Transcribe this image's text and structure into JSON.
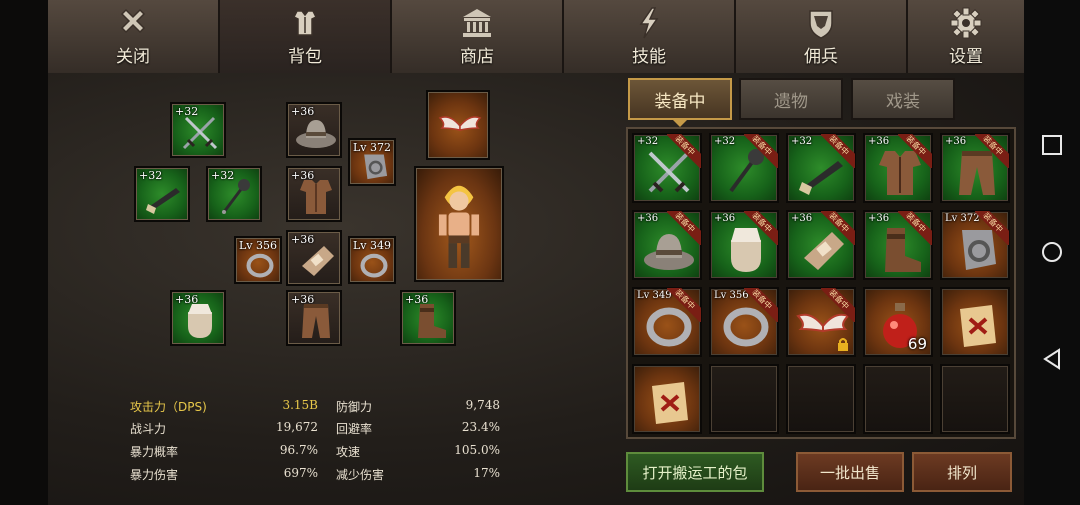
{
  "nav": {
    "tabs": [
      {
        "label": "关闭",
        "icon": "close-x-icon",
        "active": false
      },
      {
        "label": "背包",
        "icon": "armor-icon",
        "active": true
      },
      {
        "label": "商店",
        "icon": "shop-building-icon",
        "active": false
      },
      {
        "label": "技能",
        "icon": "lightning-icon",
        "active": false
      },
      {
        "label": "佣兵",
        "icon": "shield-icon",
        "active": false
      },
      {
        "label": "设置",
        "icon": "gear-icon",
        "active": false
      }
    ]
  },
  "equipment": {
    "slots": [
      {
        "badge": "+32",
        "item": "crossed-swords-icon"
      },
      {
        "badge": "+36",
        "item": "hat-icon"
      },
      {
        "badge": "Lv 372",
        "item": "bracer-icon"
      },
      {
        "badge": "+32",
        "item": "gun-icon"
      },
      {
        "badge": "+32",
        "item": "mace-icon"
      },
      {
        "badge": "+36",
        "item": "armor-chest-icon"
      },
      {
        "badge": "Lv 356",
        "item": "ring-icon"
      },
      {
        "badge": "+36",
        "item": "gauntlet-icon"
      },
      {
        "badge": "Lv 349",
        "item": "ring-icon"
      },
      {
        "badge": "+36",
        "item": "glove-icon"
      },
      {
        "badge": "+36",
        "item": "pants-icon"
      },
      {
        "badge": "+36",
        "item": "boots-icon"
      }
    ],
    "wings": "wings-icon",
    "character": "hero-character"
  },
  "stats": {
    "left": [
      {
        "label": "攻击力（DPS)",
        "value": "3.15B"
      },
      {
        "label": "战斗力",
        "value": "19,672"
      },
      {
        "label": "暴力概率",
        "value": "96.7%"
      },
      {
        "label": "暴力伤害",
        "value": "697%"
      }
    ],
    "right": [
      {
        "label": "防御力",
        "value": "9,748"
      },
      {
        "label": "回避率",
        "value": "23.4%"
      },
      {
        "label": "攻速",
        "value": "105.0%"
      },
      {
        "label": "减少伤害",
        "value": "17%"
      }
    ]
  },
  "inventory": {
    "tabs": [
      {
        "label": "装备中",
        "active": true
      },
      {
        "label": "遗物",
        "active": false
      },
      {
        "label": "戏装",
        "active": false
      }
    ],
    "equipped_tag": "装备中",
    "items": [
      {
        "badge": "+32",
        "item": "crossed-swords-icon",
        "bg": "green",
        "equipped": true
      },
      {
        "badge": "+32",
        "item": "mace-icon",
        "bg": "green",
        "equipped": true
      },
      {
        "badge": "+32",
        "item": "gun-icon",
        "bg": "green",
        "equipped": true
      },
      {
        "badge": "+36",
        "item": "armor-chest-icon",
        "bg": "green",
        "equipped": true
      },
      {
        "badge": "+36",
        "item": "pants-icon",
        "bg": "green",
        "equipped": true
      },
      {
        "badge": "+36",
        "item": "hat-icon",
        "bg": "green",
        "equipped": true
      },
      {
        "badge": "+36",
        "item": "glove-icon",
        "bg": "green",
        "equipped": true
      },
      {
        "badge": "+36",
        "item": "gauntlet-icon",
        "bg": "green",
        "equipped": true
      },
      {
        "badge": "+36",
        "item": "boots-icon",
        "bg": "green",
        "equipped": true
      },
      {
        "badge": "Lv 372",
        "item": "bracer-icon",
        "bg": "orange",
        "equipped": true
      },
      {
        "badge": "Lv 349",
        "item": "ring-icon",
        "bg": "orange",
        "equipped": true
      },
      {
        "badge": "Lv 356",
        "item": "ring-icon",
        "bg": "orange",
        "equipped": true
      },
      {
        "badge": "",
        "item": "wings-icon",
        "bg": "orange",
        "equipped": true,
        "locked": true
      },
      {
        "badge": "",
        "item": "potion-icon",
        "bg": "orange",
        "equipped": false,
        "count": "69"
      },
      {
        "badge": "",
        "item": "scroll-icon",
        "bg": "orange",
        "equipped": false
      },
      {
        "badge": "",
        "item": "scroll-icon",
        "bg": "orange",
        "equipped": false
      },
      {
        "badge": "",
        "item": "",
        "bg": "empty",
        "equipped": false
      },
      {
        "badge": "",
        "item": "",
        "bg": "empty",
        "equipped": false
      },
      {
        "badge": "",
        "item": "",
        "bg": "empty",
        "equipped": false
      },
      {
        "badge": "",
        "item": "",
        "bg": "empty",
        "equipped": false
      }
    ]
  },
  "buttons": {
    "porter_bag": "打开搬运工的包",
    "bulk_sell": "一批出售",
    "sort": "排列"
  },
  "colors": {
    "accent_gold": "#c59a48",
    "stat_highlight": "#e8c84a",
    "rarity_green": "#17631a",
    "rarity_orange": "#6d3510",
    "equipped_tag": "#7a1e14"
  }
}
